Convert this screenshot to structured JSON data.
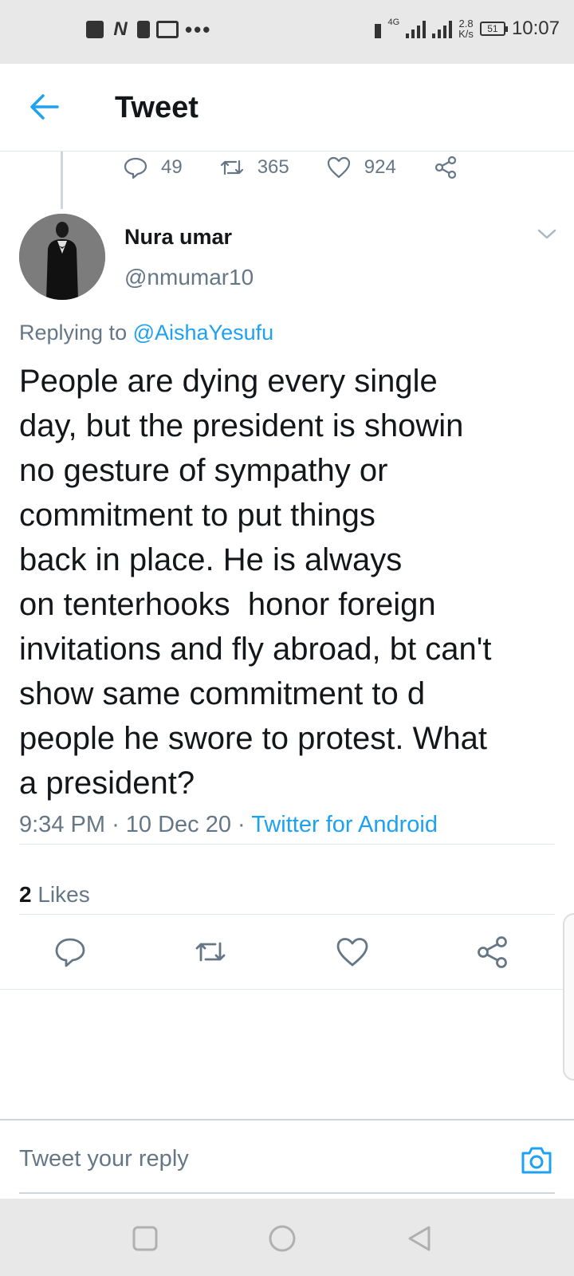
{
  "status_bar": {
    "network_type": "4G",
    "speed_value": "2.8",
    "speed_unit": "K/s",
    "battery": "51",
    "time": "10:07"
  },
  "header": {
    "title": "Tweet"
  },
  "parent_tweet_stats": {
    "replies": "49",
    "retweets": "365",
    "likes": "924"
  },
  "tweet": {
    "author_name": "Nura umar",
    "author_handle": "@nmumar10",
    "replying_prefix": "Replying to",
    "replying_to": "@AishaYesufu",
    "text_lines": [
      "People are dying every single",
      "day, but the president is showin",
      "no gesture of sympathy or",
      "commitment to put things",
      "back in place. He is always",
      "on tenterhooks  honor foreign",
      "invitations and fly abroad, bt can't",
      "show same commitment to d",
      "people he swore to protest. What",
      "a president?"
    ],
    "time": "9:34 PM",
    "date": "10 Dec 20",
    "source": "Twitter for Android",
    "likes_count": "2",
    "likes_label": "Likes"
  },
  "reply_bar": {
    "placeholder": "Tweet your reply"
  },
  "colors": {
    "accent": "#1da1f2",
    "secondary_text": "#657786",
    "primary_text": "#14171a",
    "divider": "#e1e8ed"
  }
}
